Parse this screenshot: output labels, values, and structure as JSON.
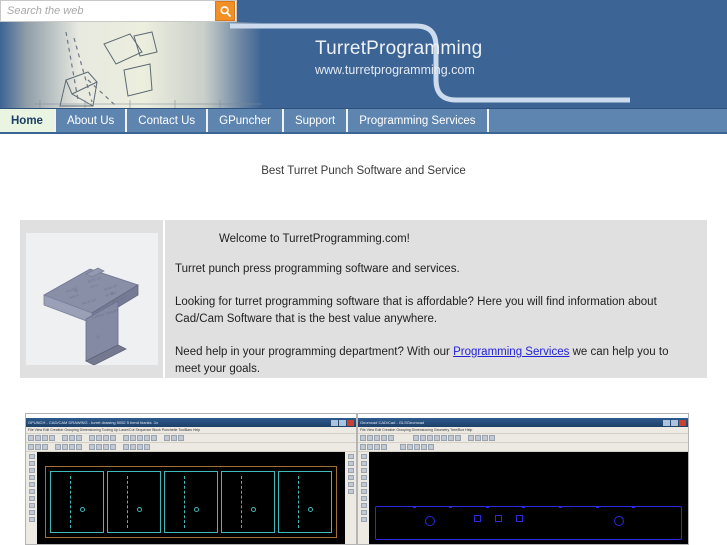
{
  "search": {
    "placeholder": "Search the web",
    "value": "",
    "button_icon": "search-icon"
  },
  "header": {
    "title": "TurretProgramming",
    "url": "www.turretprogramming.com",
    "banner_alt": "abstract-geometry-banner"
  },
  "nav": {
    "items": [
      {
        "label": "Home",
        "active": true
      },
      {
        "label": "About Us",
        "active": false
      },
      {
        "label": "Contact Us",
        "active": false
      },
      {
        "label": "GPuncher",
        "active": false
      },
      {
        "label": "Support",
        "active": false
      },
      {
        "label": "Programming Services",
        "active": false
      }
    ]
  },
  "tagline": "Best Turret Punch Software and Service",
  "content": {
    "image_alt": "3d-sheet-metal-bracket",
    "welcome": "Welcome to TurretProgramming.com!",
    "paragraph_1": "Turret punch press programming software and services.",
    "paragraph_2": "Looking for turret programming software that is affordable? Here you will find information about Cad/Cam Software that is the best value anywhere.",
    "paragraph_3_before": "Need help in your programming department? With our ",
    "paragraph_3_link": "Programming Services",
    "paragraph_3_after": " we can help you to meet your goals."
  },
  "screenshots": [
    {
      "window_title": "GPUNCH - CAD/CAM      DRAWING - turret drawing 5052 5 bend blanks .1x",
      "menu": [
        "File",
        "View",
        "Edit",
        "Creation",
        "Grouping",
        "Dimensioning",
        "Tooling Up",
        "Laser/Cut",
        "Sequence",
        "Block",
        "Punchette",
        "ToolBars",
        "Help"
      ],
      "canvas_alt": "cad-nesting-view-cyan-parts-on-black"
    },
    {
      "window_title": "Geomcad  CAD/Cad - GLSGeomcad",
      "menu": [
        "File",
        "View",
        "Edit",
        "Creation",
        "Grouping",
        "Dimensioning",
        "Geometry",
        "Tree/Box",
        "Help"
      ],
      "canvas_alt": "cad-part-view-blue-geometry-on-black"
    }
  ],
  "colors": {
    "header_blue": "#3c6494",
    "nav_blue": "#5e85b0",
    "active_tab": "#e9f5e0",
    "link_blue": "#2323d6",
    "card_gray": "#e0e0e0",
    "search_orange": "#f29026"
  }
}
